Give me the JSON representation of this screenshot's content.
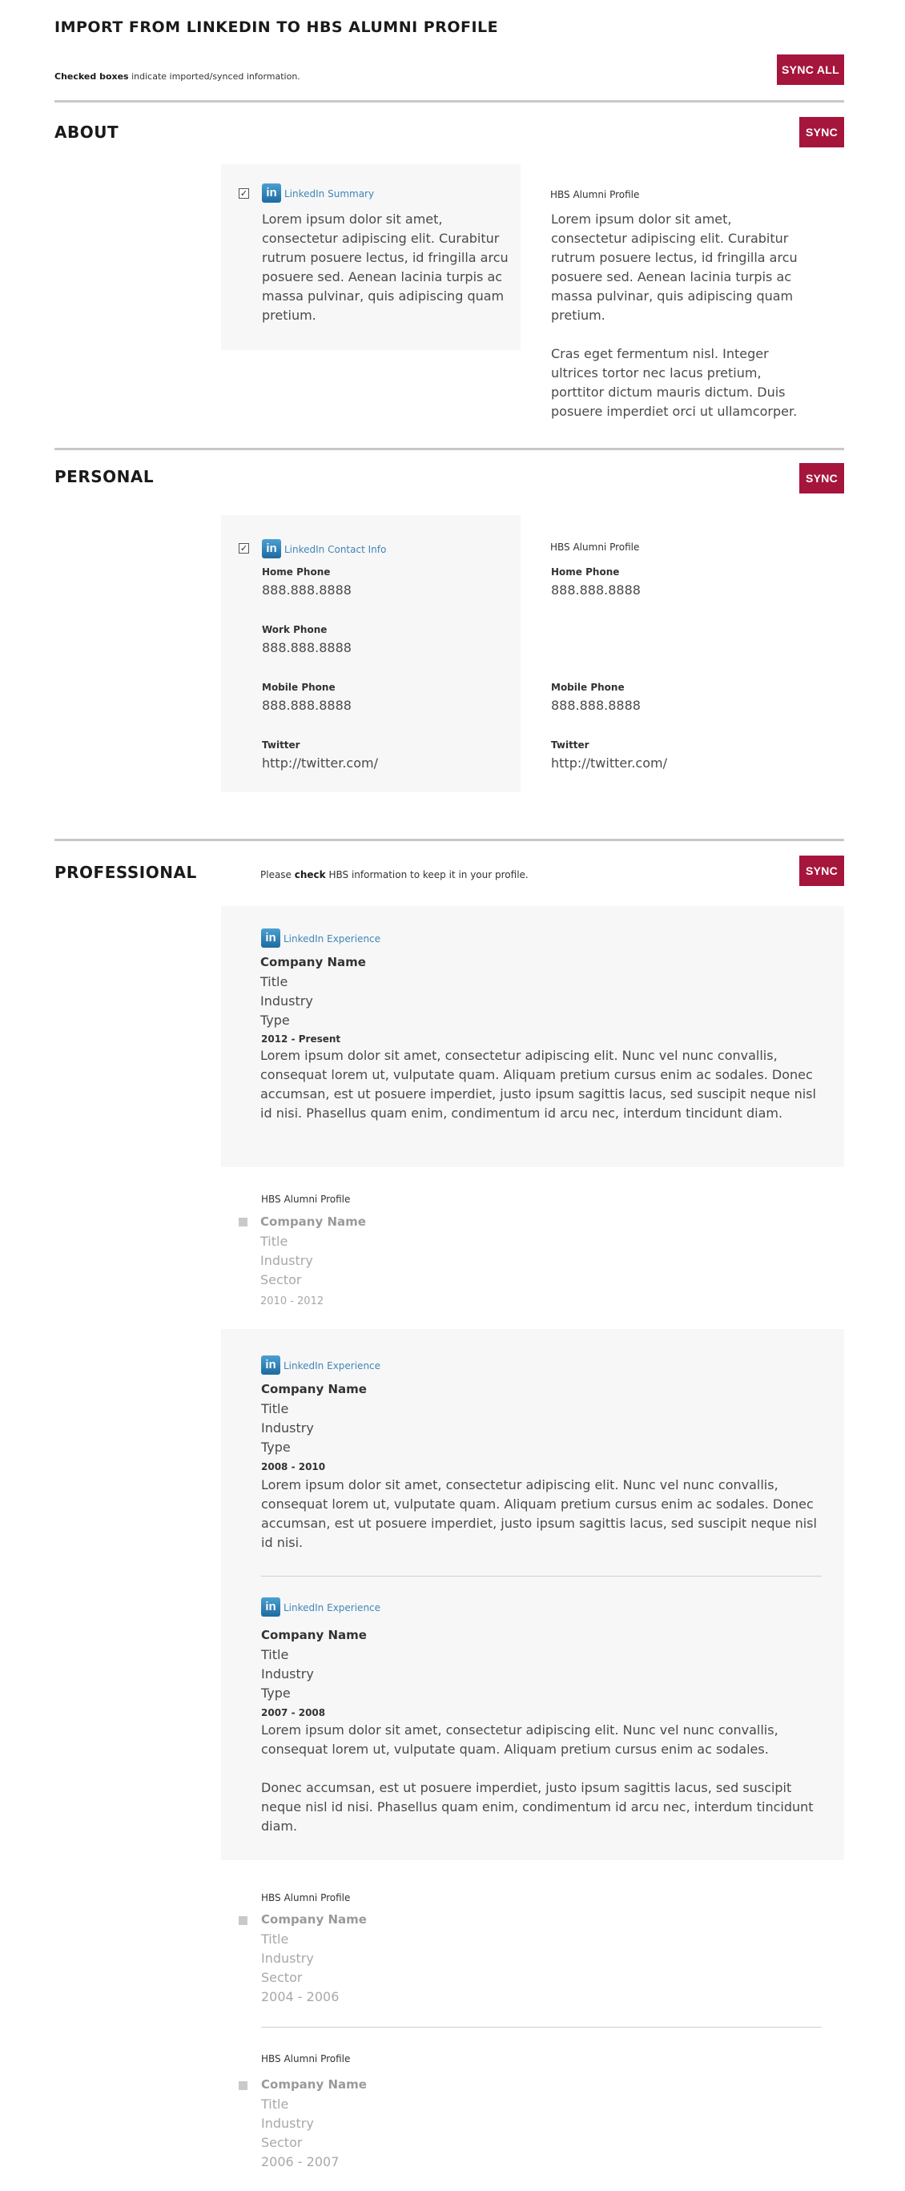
{
  "header": {
    "title": "IMPORT FROM LINKEDIN TO HBS ALUMNI PROFILE",
    "legend_bold": "Checked boxes",
    "legend_rest": " indicate imported/synced information.",
    "sync_all": "SYNC ALL"
  },
  "sync_label": "SYNC",
  "about": {
    "title": "ABOUT",
    "linkedin_label": "LinkedIn Summary",
    "linkedin_text": "Lorem ipsum dolor sit amet, consectetur adipiscing elit. Curabitur rutrum posuere lectus, id fringilla arcu posuere sed. Aenean lacinia turpis ac massa pulvinar, quis adipiscing quam pretium.",
    "hbs_label": "HBS Alumni Profile",
    "hbs_text_1": "Lorem ipsum dolor sit amet, consectetur adipiscing elit. Curabitur rutrum posuere lectus, id fringilla arcu posuere sed. Aenean lacinia turpis ac massa pulvinar, quis adipiscing quam pretium.",
    "hbs_text_2": "Cras eget fermentum nisl. Integer ultrices tortor nec lacus pretium, porttitor dictum mauris dictum. Duis posuere imperdiet orci ut ullamcorper."
  },
  "personal": {
    "title": "PERSONAL",
    "linkedin_label": "LinkedIn Contact Info",
    "hbs_label": "HBS Alumni Profile",
    "linkedin_fields": [
      {
        "label": "Home Phone",
        "value": "888.888.8888"
      },
      {
        "label": "Work Phone",
        "value": "888.888.8888"
      },
      {
        "label": "Mobile Phone",
        "value": "888.888.8888"
      },
      {
        "label": "Twitter",
        "value": "http://twitter.com/"
      }
    ],
    "hbs_fields": [
      {
        "label": "Home Phone",
        "value": "888.888.8888"
      },
      {
        "label": "Mobile Phone",
        "value": "888.888.8888"
      },
      {
        "label": "Twitter",
        "value": "http://twitter.com/"
      }
    ]
  },
  "professional": {
    "title": "PROFESSIONAL",
    "note_pre": "Please ",
    "note_bold": "check",
    "note_post": " HBS information to keep it in your profile.",
    "linkedin_label": "LinkedIn Experience",
    "hbs_label": "HBS Alumni Profile",
    "li1": {
      "company": "Company Name",
      "title": "Title",
      "industry": "Industry",
      "type": "Type",
      "dates": "2012 - Present",
      "desc": "Lorem ipsum dolor sit amet, consectetur adipiscing elit. Nunc vel nunc convallis, consequat lorem ut, vulputate quam. Aliquam pretium cursus enim ac sodales. Donec accumsan, est ut posuere imperdiet, justo ipsum sagittis lacus, sed suscipit neque nisl id nisi. Phasellus quam enim, condimentum id arcu nec, interdum tincidunt diam."
    },
    "hbs1": {
      "company": "Company Name",
      "title": "Title",
      "industry": "Industry",
      "sector": "Sector",
      "dates": "2010 - 2012"
    },
    "li2": {
      "company": "Company Name",
      "title": "Title",
      "industry": "Industry",
      "type": "Type",
      "dates": "2008 - 2010",
      "desc": "Lorem ipsum dolor sit amet, consectetur adipiscing elit. Nunc vel nunc convallis, consequat lorem ut, vulputate quam. Aliquam pretium cursus enim ac sodales. Donec accumsan, est ut posuere imperdiet, justo ipsum sagittis lacus, sed suscipit neque nisl id nisi."
    },
    "li3": {
      "company": "Company Name",
      "title": "Title",
      "industry": "Industry",
      "type": "Type",
      "dates": "2007 - 2008",
      "desc_1": "Lorem ipsum dolor sit amet, consectetur adipiscing elit. Nunc vel nunc convallis, consequat lorem ut, vulputate quam. Aliquam pretium cursus enim ac sodales.",
      "desc_2": "Donec accumsan, est ut posuere imperdiet, justo ipsum sagittis lacus, sed suscipit neque nisl id nisi. Phasellus quam enim, condimentum id arcu nec, interdum tincidunt diam."
    },
    "hbs2": {
      "company": "Company Name",
      "title": "Title",
      "industry": "Industry",
      "sector": "Sector",
      "dates": "2004 - 2006"
    },
    "hbs3": {
      "company": "Company Name",
      "title": "Title",
      "industry": "Industry",
      "sector": "Sector",
      "dates": "2006 - 2007"
    }
  },
  "icons": {
    "linkedin": "linkedin-icon",
    "check": "checkbox-checked",
    "uncheck": "checkbox-unchecked"
  },
  "colors": {
    "accent": "#a6153c",
    "linkedin_blue": "#3f86b8",
    "panel": "#f7f7f7"
  }
}
